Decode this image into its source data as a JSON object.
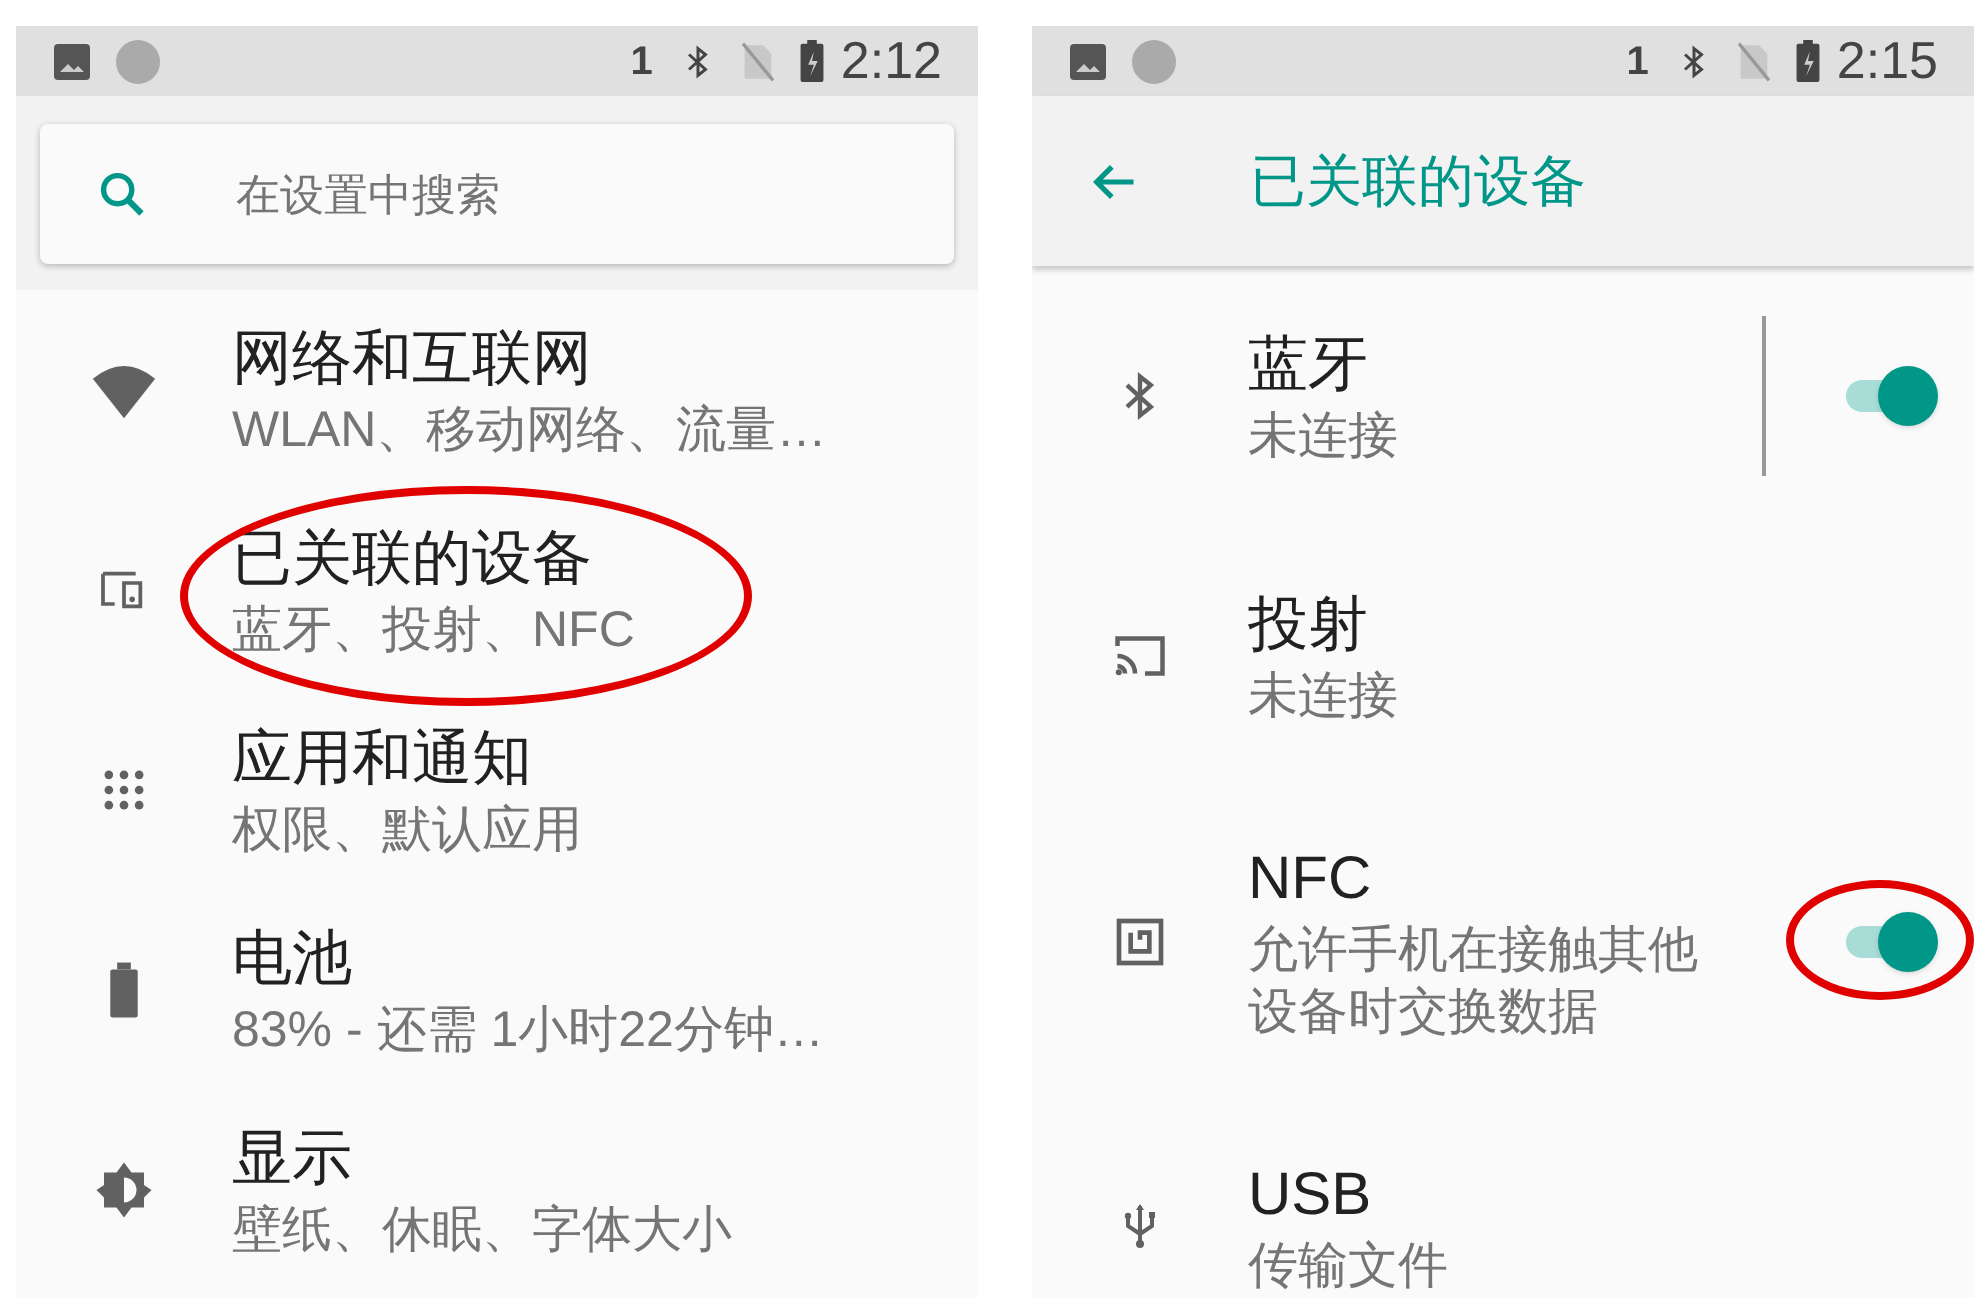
{
  "screens": [
    {
      "status_bar": {
        "sim": "1",
        "time": "2:12"
      },
      "search": {
        "placeholder": "在设置中搜索"
      },
      "items": [
        {
          "title": "网络和互联网",
          "subtitle": "WLAN、移动网络、流量…"
        },
        {
          "title": "已关联的设备",
          "subtitle": "蓝牙、投射、NFC",
          "circled": true
        },
        {
          "title": "应用和通知",
          "subtitle": "权限、默认应用"
        },
        {
          "title": "电池",
          "subtitle": "83% - 还需 1小时22分钟…"
        },
        {
          "title": "显示",
          "subtitle": "壁纸、休眠、字体大小"
        }
      ]
    },
    {
      "status_bar": {
        "sim": "1",
        "time": "2:15"
      },
      "toolbar": {
        "title": "已关联的设备"
      },
      "items": [
        {
          "title": "蓝牙",
          "subtitle": "未连接",
          "switch": {
            "on": true,
            "divider": true
          }
        },
        {
          "title": "投射",
          "subtitle": "未连接"
        },
        {
          "title": "NFC",
          "subtitle": "允许手机在接触其他设备时交换数据",
          "switch": {
            "on": true,
            "circled": true
          }
        },
        {
          "title": "USB",
          "subtitle": "传输文件"
        }
      ]
    }
  ]
}
